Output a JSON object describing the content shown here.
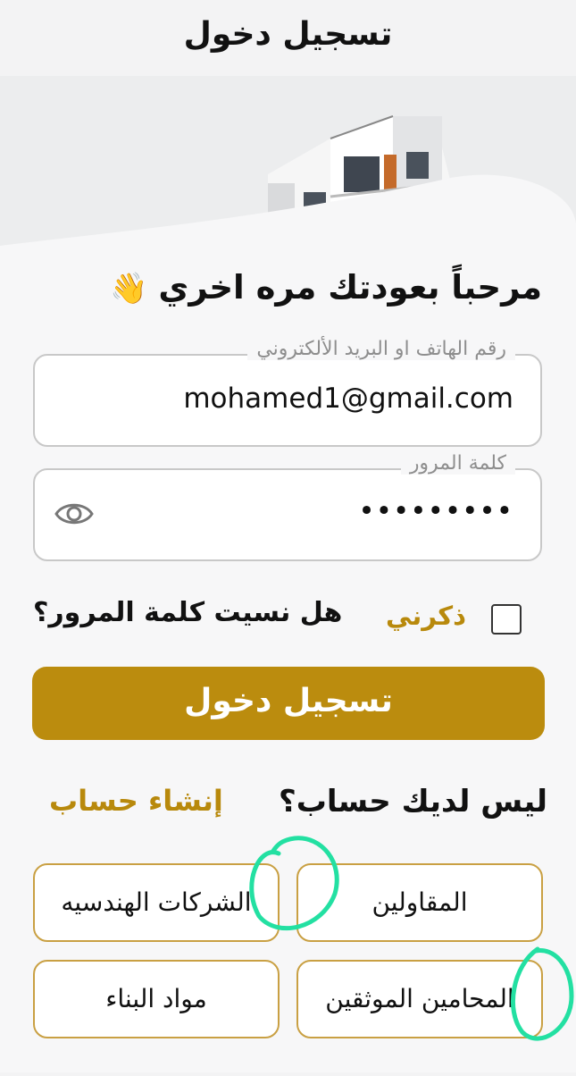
{
  "header": {
    "title": "تسجيل دخول"
  },
  "welcome": {
    "text": "مرحباً بعودتك مره اخري",
    "emoji": "👋"
  },
  "form": {
    "identifier": {
      "label": "رقم الهاتف او البريد الألكتروني",
      "value": "mohamed1@gmail.com"
    },
    "password": {
      "label": "كلمة المرور",
      "value": "•••••••••"
    },
    "remember_label": "ذكرني",
    "forgot_label": "هل نسيت كلمة المرور؟",
    "submit_label": "تسجيل دخول"
  },
  "signup": {
    "prompt": "ليس لديك حساب؟",
    "link_label": "إنشاء حساب"
  },
  "categories": [
    {
      "label": "المقاولين"
    },
    {
      "label": "الشركات الهندسيه"
    },
    {
      "label": "المحامين الموثقين"
    },
    {
      "label": "مواد البناء"
    }
  ],
  "colors": {
    "accent": "#bb8c0e",
    "accent_text": "#b8890c",
    "annotation": "#23e0a2",
    "border": "#c9a043"
  },
  "icons": {
    "password_toggle": "eye-icon",
    "wave": "waving-hand-icon"
  }
}
